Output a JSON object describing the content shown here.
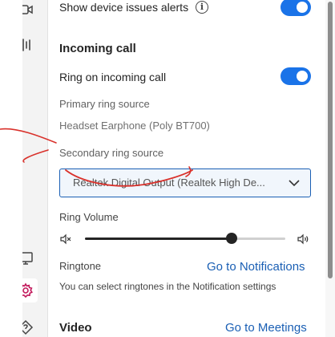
{
  "settings": {
    "device_alerts_label": "Show device issues alerts",
    "device_alerts_on": true,
    "incoming_call_heading": "Incoming call",
    "ring_on_incoming_label": "Ring on incoming call",
    "ring_on_incoming_on": true,
    "primary_ring_source_label": "Primary ring source",
    "primary_ring_source_value": "Headset Earphone (Poly BT700)",
    "secondary_ring_source_label": "Secondary ring source",
    "secondary_ring_source_value": "Realtek Digital Output (Realtek High De...",
    "ring_volume_label": "Ring Volume",
    "ring_volume_level": 0.73,
    "ringtone_label": "Ringtone",
    "ringtone_link": "Go to Notifications",
    "ringtone_note": "You can select ringtones in the Notification settings",
    "video_heading": "Video",
    "video_link": "Go to Meetings"
  },
  "colors": {
    "accent": "#1a73e8",
    "link": "#1a5fb4",
    "annotation": "#d9312b"
  },
  "icons": {
    "rail": [
      "camera-icon",
      "audio-waves-icon",
      "monitor-icon",
      "settings-icon",
      "help-icon"
    ]
  }
}
